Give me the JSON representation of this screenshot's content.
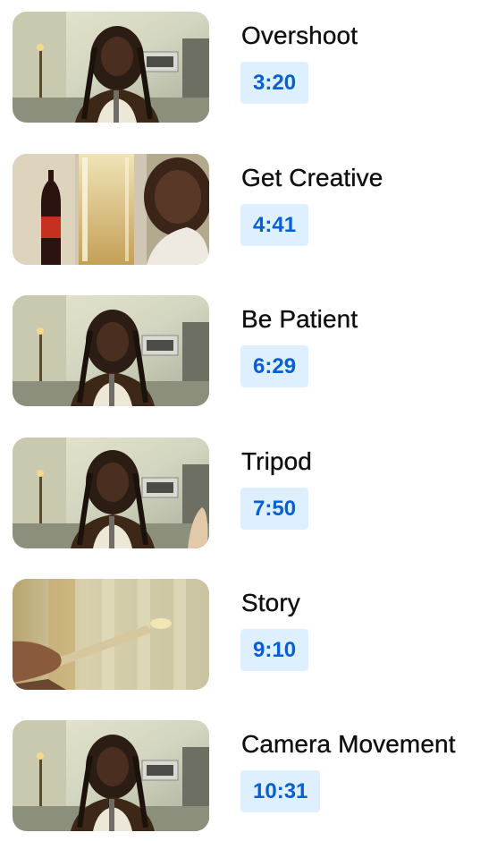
{
  "chapters": [
    {
      "title": "Overshoot",
      "timestamp": "3:20",
      "thumbnail_icon": "person-in-kitchen-thumbnail"
    },
    {
      "title": "Get Creative",
      "timestamp": "4:41",
      "thumbnail_icon": "champagne-glass-thumbnail"
    },
    {
      "title": "Be Patient",
      "timestamp": "6:29",
      "thumbnail_icon": "person-in-kitchen-thumbnail"
    },
    {
      "title": "Tripod",
      "timestamp": "7:50",
      "thumbnail_icon": "person-in-kitchen-thumbnail"
    },
    {
      "title": "Story",
      "timestamp": "9:10",
      "thumbnail_icon": "hand-holding-whisk-thumbnail"
    },
    {
      "title": "Camera Movement",
      "timestamp": "10:31",
      "thumbnail_icon": "person-in-kitchen-thumbnail"
    }
  ],
  "colors": {
    "timestamp_text": "#065fd4",
    "timestamp_background": "#deefff",
    "title_text": "#0f0f0f"
  }
}
